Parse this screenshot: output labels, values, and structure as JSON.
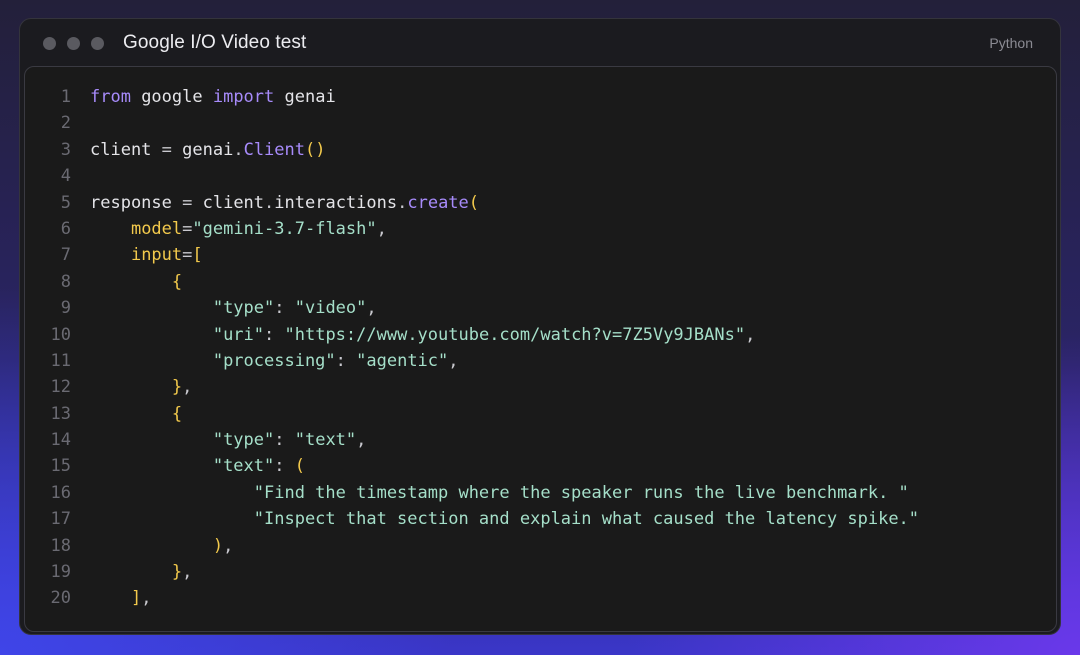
{
  "window": {
    "title": "Google I/O Video test",
    "language": "Python"
  },
  "code": {
    "lines": [
      {
        "n": "1",
        "tokens": [
          {
            "t": "from",
            "c": "kw"
          },
          {
            "t": " google ",
            "c": ""
          },
          {
            "t": "import",
            "c": "kw"
          },
          {
            "t": " genai",
            "c": ""
          }
        ]
      },
      {
        "n": "2",
        "tokens": []
      },
      {
        "n": "3",
        "tokens": [
          {
            "t": "client ",
            "c": ""
          },
          {
            "t": "=",
            "c": "pn"
          },
          {
            "t": " genai",
            "c": ""
          },
          {
            "t": ".",
            "c": "pn"
          },
          {
            "t": "Client",
            "c": "fn"
          },
          {
            "t": "()",
            "c": "br"
          }
        ]
      },
      {
        "n": "4",
        "tokens": []
      },
      {
        "n": "5",
        "tokens": [
          {
            "t": "response ",
            "c": ""
          },
          {
            "t": "=",
            "c": "pn"
          },
          {
            "t": " client",
            "c": ""
          },
          {
            "t": ".",
            "c": "pn"
          },
          {
            "t": "interactions",
            "c": ""
          },
          {
            "t": ".",
            "c": "pn"
          },
          {
            "t": "create",
            "c": "fn"
          },
          {
            "t": "(",
            "c": "br"
          }
        ]
      },
      {
        "n": "6",
        "tokens": [
          {
            "t": "    ",
            "c": ""
          },
          {
            "t": "model",
            "c": "prm"
          },
          {
            "t": "=",
            "c": "pn"
          },
          {
            "t": "\"gemini-3.7-flash\"",
            "c": "str"
          },
          {
            "t": ",",
            "c": "pn"
          }
        ]
      },
      {
        "n": "7",
        "tokens": [
          {
            "t": "    ",
            "c": ""
          },
          {
            "t": "input",
            "c": "prm"
          },
          {
            "t": "=",
            "c": "pn"
          },
          {
            "t": "[",
            "c": "br"
          }
        ]
      },
      {
        "n": "8",
        "tokens": [
          {
            "t": "        ",
            "c": ""
          },
          {
            "t": "{",
            "c": "br"
          }
        ]
      },
      {
        "n": "9",
        "tokens": [
          {
            "t": "            ",
            "c": ""
          },
          {
            "t": "\"type\"",
            "c": "str"
          },
          {
            "t": ": ",
            "c": "pn"
          },
          {
            "t": "\"video\"",
            "c": "str"
          },
          {
            "t": ",",
            "c": "pn"
          }
        ]
      },
      {
        "n": "10",
        "tokens": [
          {
            "t": "            ",
            "c": ""
          },
          {
            "t": "\"uri\"",
            "c": "str"
          },
          {
            "t": ": ",
            "c": "pn"
          },
          {
            "t": "\"https://www.youtube.com/watch?v=7Z5Vy9JBANs\"",
            "c": "str"
          },
          {
            "t": ",",
            "c": "pn"
          }
        ]
      },
      {
        "n": "11",
        "tokens": [
          {
            "t": "            ",
            "c": ""
          },
          {
            "t": "\"processing\"",
            "c": "str"
          },
          {
            "t": ": ",
            "c": "pn"
          },
          {
            "t": "\"agentic\"",
            "c": "str"
          },
          {
            "t": ",",
            "c": "pn"
          }
        ]
      },
      {
        "n": "12",
        "tokens": [
          {
            "t": "        ",
            "c": ""
          },
          {
            "t": "}",
            "c": "br"
          },
          {
            "t": ",",
            "c": "pn"
          }
        ]
      },
      {
        "n": "13",
        "tokens": [
          {
            "t": "        ",
            "c": ""
          },
          {
            "t": "{",
            "c": "br"
          }
        ]
      },
      {
        "n": "14",
        "tokens": [
          {
            "t": "            ",
            "c": ""
          },
          {
            "t": "\"type\"",
            "c": "str"
          },
          {
            "t": ": ",
            "c": "pn"
          },
          {
            "t": "\"text\"",
            "c": "str"
          },
          {
            "t": ",",
            "c": "pn"
          }
        ]
      },
      {
        "n": "15",
        "tokens": [
          {
            "t": "            ",
            "c": ""
          },
          {
            "t": "\"text\"",
            "c": "str"
          },
          {
            "t": ": ",
            "c": "pn"
          },
          {
            "t": "(",
            "c": "br"
          }
        ]
      },
      {
        "n": "16",
        "tokens": [
          {
            "t": "                ",
            "c": ""
          },
          {
            "t": "\"Find the timestamp where the speaker runs the live benchmark. \"",
            "c": "str"
          }
        ]
      },
      {
        "n": "17",
        "tokens": [
          {
            "t": "                ",
            "c": ""
          },
          {
            "t": "\"Inspect that section and explain what caused the latency spike.\"",
            "c": "str"
          }
        ]
      },
      {
        "n": "18",
        "tokens": [
          {
            "t": "            ",
            "c": ""
          },
          {
            "t": ")",
            "c": "br"
          },
          {
            "t": ",",
            "c": "pn"
          }
        ]
      },
      {
        "n": "19",
        "tokens": [
          {
            "t": "        ",
            "c": ""
          },
          {
            "t": "}",
            "c": "br"
          },
          {
            "t": ",",
            "c": "pn"
          }
        ]
      },
      {
        "n": "20",
        "tokens": [
          {
            "t": "    ",
            "c": ""
          },
          {
            "t": "]",
            "c": "br"
          },
          {
            "t": ",",
            "c": "pn"
          }
        ]
      }
    ]
  }
}
